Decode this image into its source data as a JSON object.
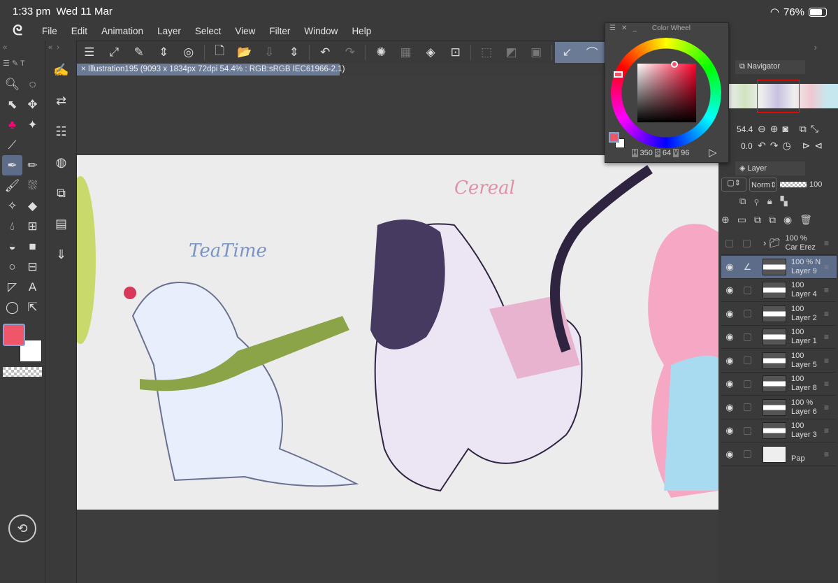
{
  "status": {
    "time": "1:33 pm",
    "date": "Wed 11 Mar",
    "battery": "76%",
    "battery_level": 0.76
  },
  "menu": {
    "logo": "ঽ",
    "items": [
      "File",
      "Edit",
      "Animation",
      "Layer",
      "Select",
      "View",
      "Filter",
      "Window",
      "Help"
    ]
  },
  "document": {
    "tab_title": "Illustration195 (9093 x 1834px 72dpi 54.4% : RGB:sRGB IEC61966-2.1)",
    "close": "×"
  },
  "artwork": {
    "label1": "TeaTime",
    "label2": "Cereal"
  },
  "color_wheel": {
    "title": "Color Wheel",
    "h_label": "H",
    "h": "350",
    "s_label": "S",
    "s": "64",
    "v_label": "V",
    "v": "96",
    "main_color": "#f0566a",
    "sub_color": "#ffffff"
  },
  "navigator": {
    "title": "Navigator",
    "zoom": "54.4",
    "rotation": "0.0"
  },
  "layer_panel": {
    "title": "Layer",
    "blend_mode": "Norm",
    "opacity": "100",
    "layers": [
      {
        "opacity": "100 %",
        "name": "Car Erez",
        "type": "folder"
      },
      {
        "opacity": "100 % N",
        "name": "Layer 9",
        "selected": true
      },
      {
        "opacity": "100",
        "name": "Layer 4"
      },
      {
        "opacity": "100",
        "name": "Layer 2"
      },
      {
        "opacity": "100",
        "name": "Layer 1"
      },
      {
        "opacity": "100",
        "name": "Layer 5"
      },
      {
        "opacity": "100",
        "name": "Layer 8"
      },
      {
        "opacity": "100 %",
        "name": "Layer 6"
      },
      {
        "opacity": "100",
        "name": "Layer 3"
      },
      {
        "opacity": "",
        "name": "Pap",
        "type": "paper"
      }
    ]
  }
}
